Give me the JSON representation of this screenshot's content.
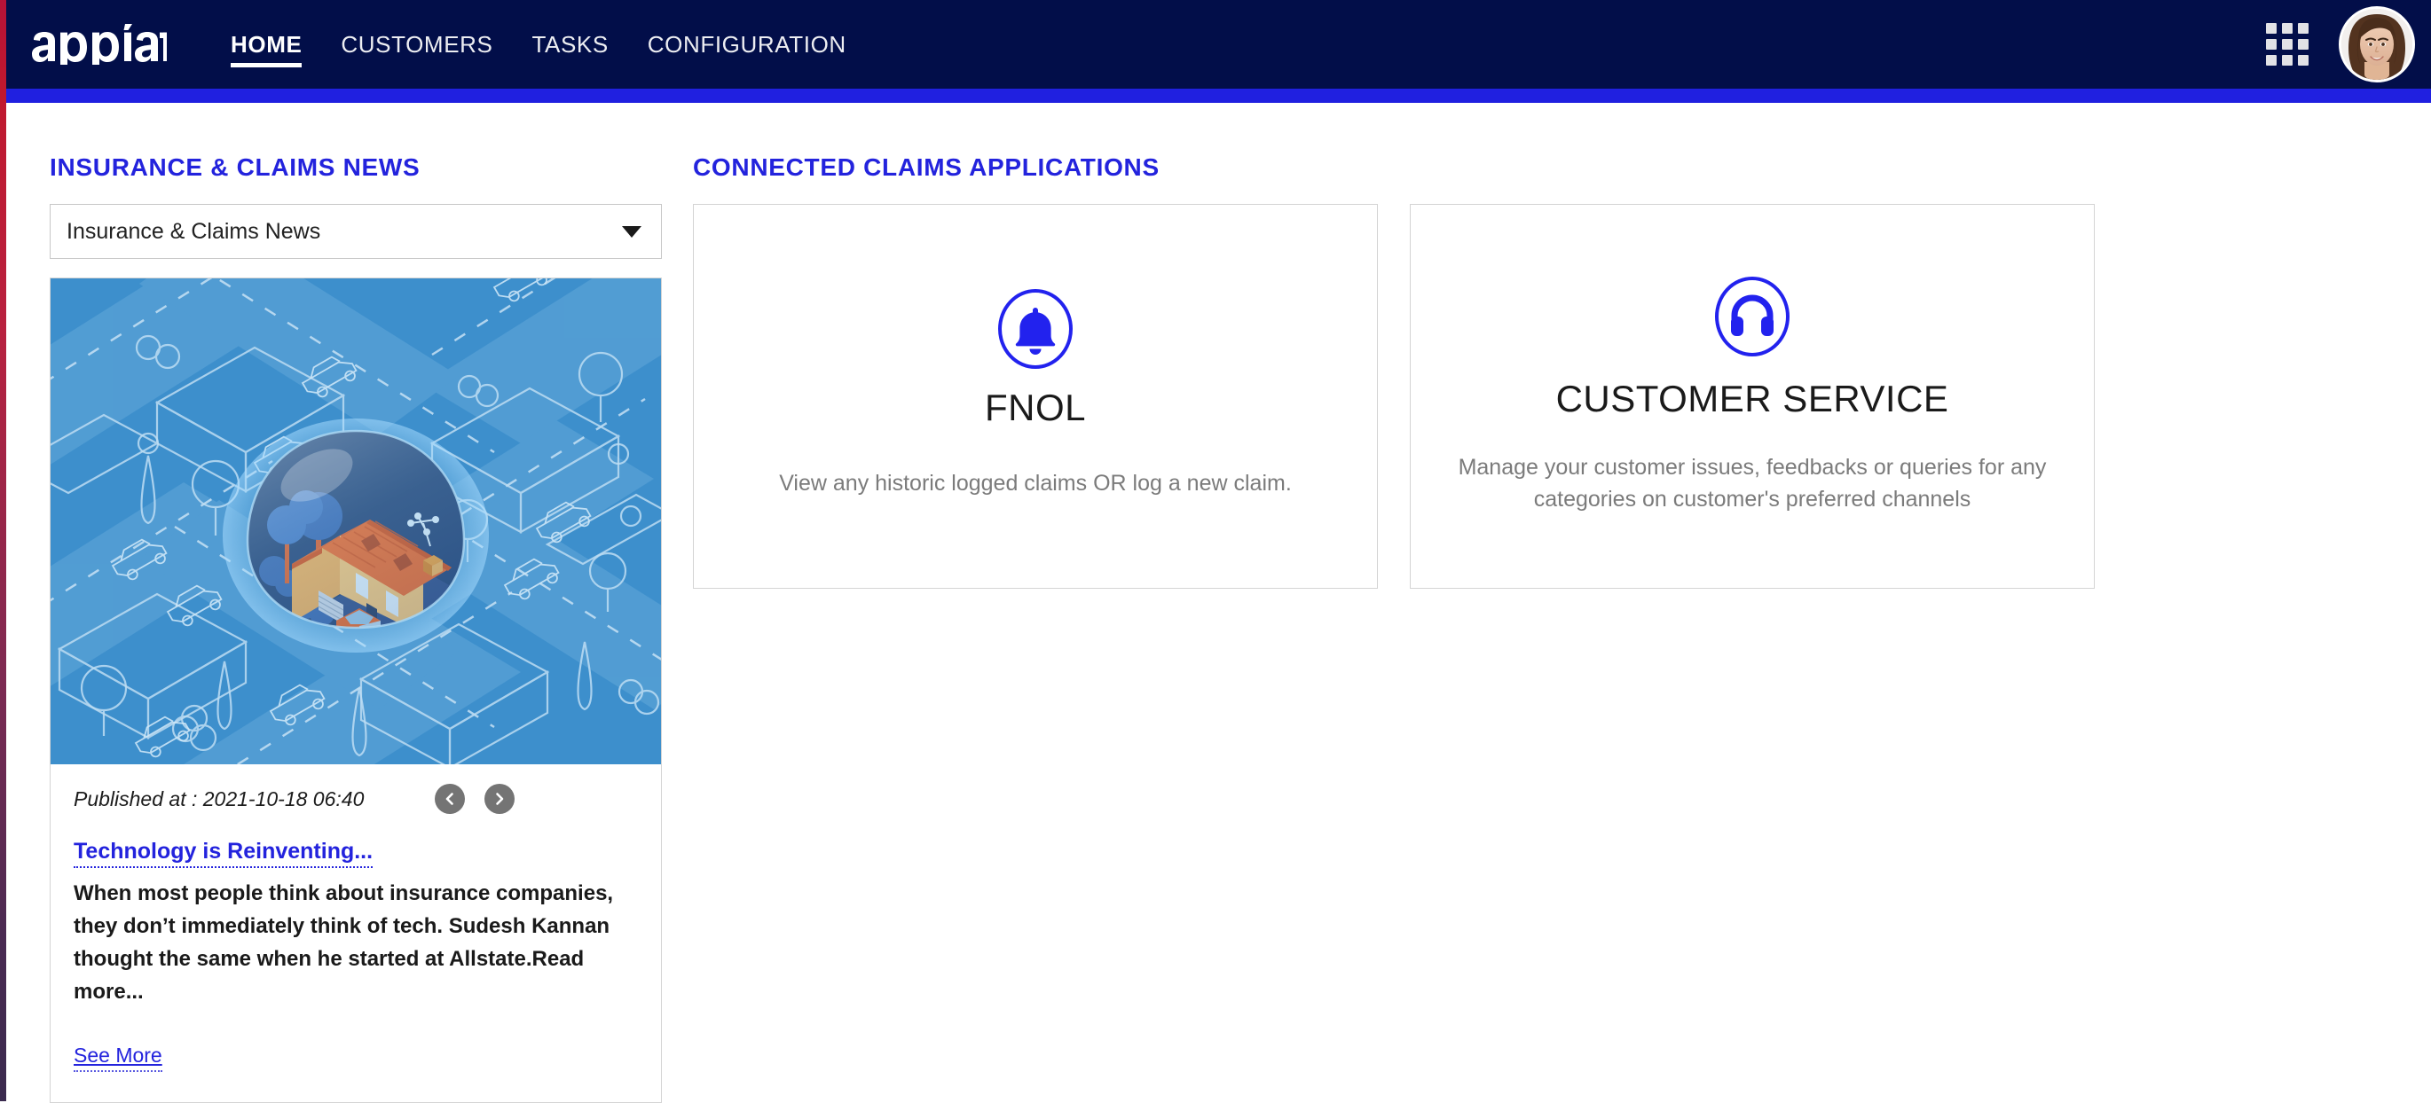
{
  "brand": {
    "logo_text": "appian",
    "logo_icon": "appian-wordmark"
  },
  "nav": {
    "items": [
      {
        "label": "HOME",
        "active": true
      },
      {
        "label": "CUSTOMERS",
        "active": false
      },
      {
        "label": "TASKS",
        "active": false
      },
      {
        "label": "CONFIGURATION",
        "active": false
      }
    ],
    "apps_grid_icon": "apps-grid-icon",
    "avatar_icon": "user-avatar-photo",
    "accent_color": "#2020e0",
    "bar_color": "#020e49"
  },
  "news": {
    "heading": "INSURANCE & CLAIMS NEWS",
    "source_select": {
      "value": "Insurance & Claims News",
      "chevron_icon": "chevron-down-icon"
    },
    "image_alt": "isometric-neighborhood-house-protected-illustration",
    "published_label": "Published at : 2021-10-18 06:40",
    "prev_icon": "chevron-left-circle-icon",
    "next_icon": "chevron-right-circle-icon",
    "title": "Technology is Reinventing...",
    "excerpt": "When most people think about insurance companies, they don’t immediately think of tech. Sudesh Kannan thought the same when he started at Allstate.Read more...",
    "see_more_label": "See More",
    "link_color": "#2323dd"
  },
  "applications": {
    "heading": "CONNECTED CLAIMS APPLICATIONS",
    "cards": [
      {
        "icon": "bell-icon",
        "title": "FNOL",
        "description": "View any historic logged claims OR log a new claim."
      },
      {
        "icon": "headset-icon",
        "title": "CUSTOMER SERVICE",
        "description": "Manage your customer issues, feedbacks or queries for any categories on customer's preferred channels"
      }
    ]
  },
  "theme": {
    "accent_blue": "#2323dd",
    "nav_navy": "#020e49",
    "left_strip_top": "#b51238",
    "left_strip_bottom": "#3a2a4e"
  }
}
